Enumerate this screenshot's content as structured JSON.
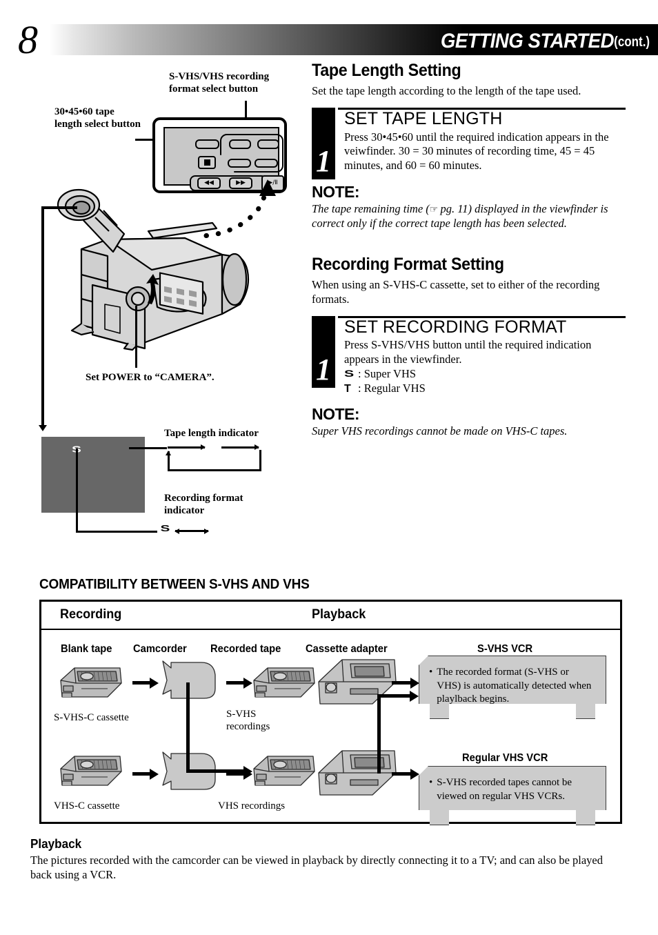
{
  "header": {
    "page_number": "8",
    "title": "GETTING STARTED",
    "cont": "(cont.)"
  },
  "tape_length_section": {
    "title": "Tape Length Setting",
    "intro": "Set the tape length according to the length of the tape used.",
    "step_number": "1",
    "step_heading": "SET TAPE LENGTH",
    "step_text": "Press 30•45•60 until the required indication appears in the veiwfinder. 30 = 30 minutes of recording time, 45 = 45 minutes, and 60 = 60 minutes.",
    "note_label": "NOTE:",
    "note_pre": "The tape remaining time (",
    "note_hand_icon": "pointing-hand-icon",
    "note_pg": " pg. 11) displayed in the viewfinder is correct only if the correct tape length has been selected."
  },
  "recording_format_section": {
    "title": "Recording Format Setting",
    "intro": "When using an S-VHS-C cassette, set to either of the recording formats.",
    "step_number": "1",
    "step_heading": "SET RECORDING FORMAT",
    "step_text": "Press S-VHS/VHS button until the required indication appears in the viewfinder.",
    "format_s_glyph": "S",
    "format_s_label": ": Super VHS",
    "format_t_glyph": "T",
    "format_t_label": ": Regular VHS",
    "note_label": "NOTE:",
    "note_body": "Super VHS recordings cannot be made on VHS-C tapes."
  },
  "illustration": {
    "label_svhs_button": "S-VHS/VHS recording format select button",
    "label_tape_length_button": "30•45•60 tape length select button",
    "label_power": "Set POWER to “CAMERA”.",
    "label_tape_length_indicator": "Tape length indicator",
    "label_recording_format_indicator": "Recording format indicator",
    "viewfinder_indicator": "S",
    "format_indicator_glyph": "S",
    "transport_rewind": "◀◀",
    "transport_forward": "▶▶",
    "transport_playpause": "▶/Ⅱ",
    "transport_stop": "stop-square-icon"
  },
  "compatibility": {
    "title": "COMPATIBILITY BETWEEN S-VHS AND VHS",
    "header_recording": "Recording",
    "header_playback": "Playback",
    "col_blank_tape": "Blank tape",
    "col_camcorder": "Camcorder",
    "col_recorded_tape": "Recorded tape",
    "col_cassette_adapter": "Cassette adapter",
    "col_svhs_vcr": "S-VHS VCR",
    "col_regular_vhs_vcr": "Regular VHS VCR",
    "caption_svhsc_cassette": "S-VHS-C cassette",
    "caption_vhsc_cassette": "VHS-C cassette",
    "caption_svhs_recordings": "S-VHS\nrecordings",
    "caption_svhs_recordings_line1": "S-VHS",
    "caption_svhs_recordings_line2": "recordings",
    "caption_vhs_recordings": "VHS recordings",
    "bubble_svhs_vcr": "The recorded format (S-VHS or VHS) is automatically detected when playlback begins.",
    "bubble_regular_vcr": "S-VHS recorded tapes cannot be viewed on regular VHS VCRs.",
    "bullet": "•"
  },
  "playback": {
    "title": "Playback",
    "body": "The pictures recorded with the camcorder can be viewed in playback by directly connecting it to a TV; and can also be played back using a VCR."
  },
  "colors": {
    "panel_gray": "#c8c8c8",
    "viewfinder_gray": "#676767",
    "bubble_gray": "#cccccc",
    "cassette_gray": "#b9b9b9"
  }
}
